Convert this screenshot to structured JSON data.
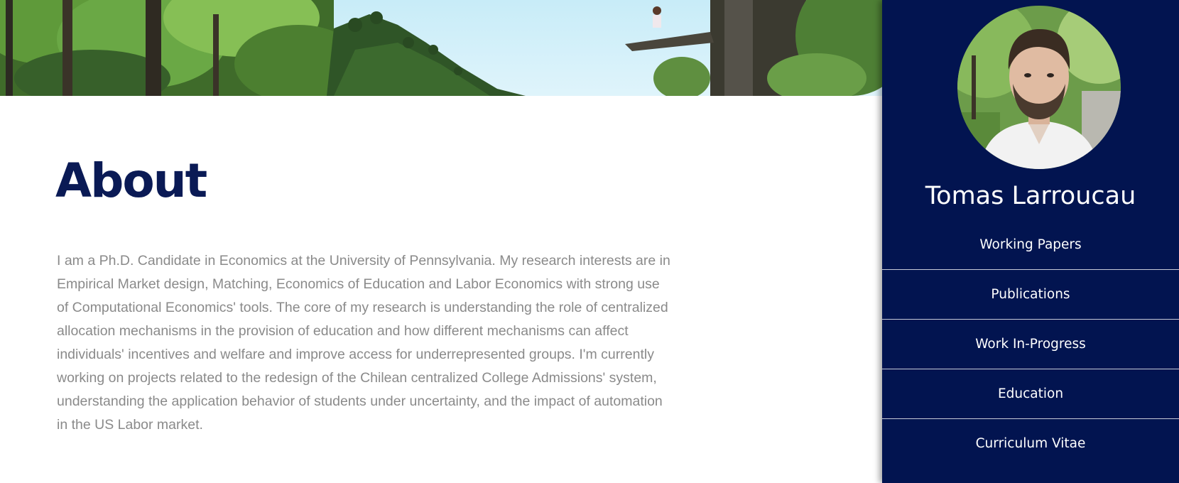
{
  "about": {
    "title": "About",
    "text": "I am a Ph.D. Candidate in Economics at the University of Pennsylvania. My research interests are in Empirical Market design, Matching, Economics of Education and Labor Economics with strong use of Computational Economics' tools. The core of my research is understanding the role of centralized allocation mechanisms in the provision of education and how different mechanisms can affect individuals' incentives and welfare and improve access for underrepresented groups. I'm currently working on projects related to the redesign of the Chilean centralized College Admissions' system, understanding the application behavior of students under uncertainty, and the impact of automation in the US Labor market."
  },
  "sidebar": {
    "name": "Tomas Larroucau",
    "nav": [
      {
        "label": "Working Papers"
      },
      {
        "label": "Publications"
      },
      {
        "label": "Work In-Progress"
      },
      {
        "label": "Education"
      },
      {
        "label": "Curriculum Vitae"
      }
    ]
  },
  "colors": {
    "sidebar_bg": "#021450",
    "title": "#0a1a55",
    "body_text": "#8a8a8a"
  },
  "images": {
    "banner": "forest-banner",
    "avatar": "profile-photo"
  }
}
